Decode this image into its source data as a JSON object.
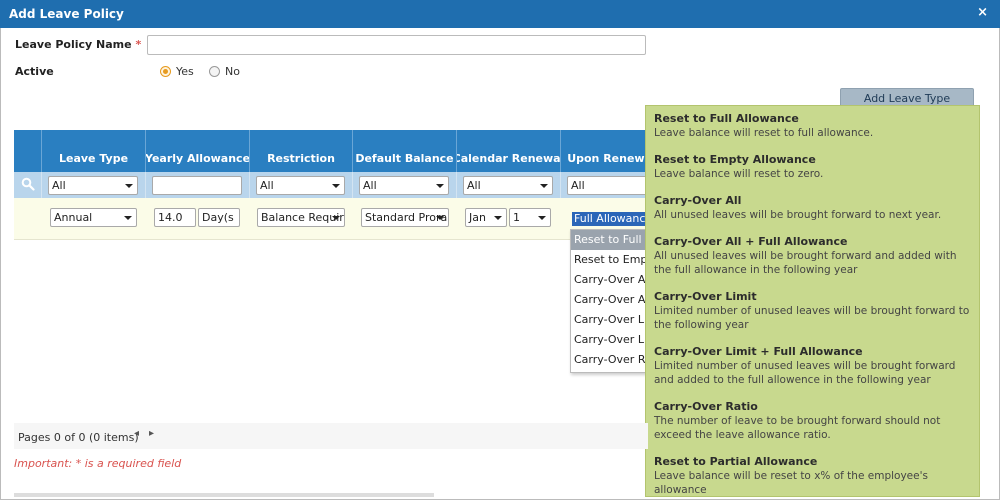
{
  "dialog": {
    "title": "Add Leave Policy",
    "close_label": "×"
  },
  "form": {
    "policy_name_label": "Leave Policy Name",
    "required_mark": "*",
    "policy_name_value": "",
    "active_label": "Active",
    "yes_label": "Yes",
    "no_label": "No",
    "active_selected": "Yes"
  },
  "add_button_label": "Add Leave Type",
  "grid": {
    "columns": [
      "Leave Type",
      "Yearly Allowance",
      "Restriction",
      "Default Balance",
      "Calendar Renewal",
      "Upon Renewal"
    ],
    "filters": {
      "leave_type": "All",
      "yearly_allowance": "",
      "restriction": "All",
      "default_balance": "All",
      "calendar_renewal": "All",
      "upon_renewal": "All"
    },
    "row": {
      "leave_type": "Annual",
      "allowance_value": "14.0",
      "allowance_unit": "Day(s",
      "restriction": "Balance Requir",
      "default_balance": "Standard Prora",
      "renewal_month": "Jan",
      "renewal_day": "1",
      "upon_renewal": "Full Allowance"
    }
  },
  "upon_renewal_options": [
    "Reset to Full A",
    "Reset to Empty",
    "Carry-Over All",
    "Carry-Over All +",
    "Carry-Over Limi",
    "Carry-Over Limi",
    "Carry-Over Rati"
  ],
  "tooltip": [
    {
      "title": "Reset to Full Allowance",
      "desc": "Leave balance will reset to full allowance."
    },
    {
      "title": "Reset to Empty Allowance",
      "desc": "Leave balance will reset to zero."
    },
    {
      "title": "Carry-Over All",
      "desc": "All unused leaves will be brought forward to next year."
    },
    {
      "title": "Carry-Over All + Full Allowance",
      "desc": "All unused leaves will be brought forward and added with the full allowance in the following year"
    },
    {
      "title": "Carry-Over Limit",
      "desc": "Limited number of unused leaves will be brought forward to the following year"
    },
    {
      "title": "Carry-Over Limit + Full Allowance",
      "desc": "Limited number of unused leaves will be brought forward and added to the full allowence in the following year"
    },
    {
      "title": "Carry-Over Ratio",
      "desc": "The number of leave to be brought forward should not exceed the leave allowance ratio."
    },
    {
      "title": "Reset to Partial Allowance",
      "desc": "Leave balance will be reset to x% of the employee's allowance"
    }
  ],
  "pager": {
    "text": "Pages 0 of 0 (0 items)",
    "prev": "◂",
    "next": "▸"
  },
  "important_note": "Important: * is a required field",
  "colors": {
    "header": "#1f6eaf",
    "grid_header": "#2a7fc1",
    "tooltip_bg": "#c8d98e",
    "accent_radio": "#e79b1f"
  }
}
